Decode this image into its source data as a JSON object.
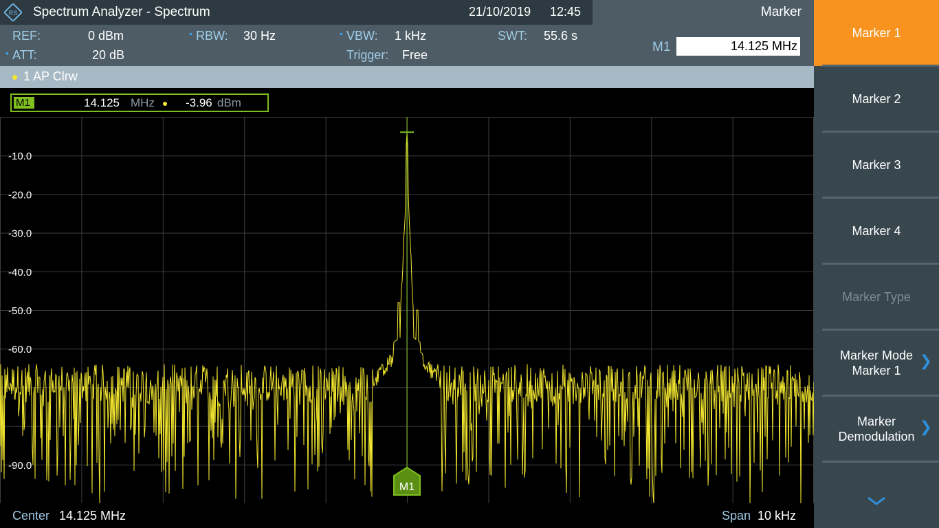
{
  "titlebar": {
    "title": "Spectrum Analyzer - Spectrum",
    "date": "21/10/2019",
    "time": "12:45"
  },
  "marker_panel": {
    "heading": "Marker",
    "m1_label": "M1",
    "m1_value": "14.125 MHz"
  },
  "settings": {
    "ref_label": "REF:",
    "ref_value": "0 dBm",
    "att_label": "ATT:",
    "att_value": "20 dB",
    "rbw_label": "RBW:",
    "rbw_value": "30 Hz",
    "vbw_label": "VBW:",
    "vbw_value": "1 kHz",
    "trigger_label": "Trigger:",
    "trigger_value": "Free",
    "swt_label": "SWT:",
    "swt_value": "55.6 s"
  },
  "trace": {
    "label": "1 AP  Clrw"
  },
  "marker_table": {
    "tag": "M1",
    "freq_value": "14.125",
    "freq_unit": "MHz",
    "level_value": "-3.96",
    "level_unit": "dBm"
  },
  "bottom": {
    "center_label": "Center",
    "center_value": "14.125 MHz",
    "span_label": "Span",
    "span_value": "10 kHz"
  },
  "softkeys": [
    {
      "label": "Marker 1",
      "state": "active"
    },
    {
      "label": "Marker 2",
      "state": "normal"
    },
    {
      "label": "Marker 3",
      "state": "normal"
    },
    {
      "label": "Marker 4",
      "state": "normal"
    },
    {
      "label": "Marker Type",
      "state": "disabled"
    },
    {
      "label": "Marker Mode\nMarker 1",
      "state": "submenu"
    },
    {
      "label": "Marker\nDemodulation",
      "state": "submenu"
    }
  ],
  "colors": {
    "trace": "#f4e830",
    "marker": "#7fbf1f",
    "active_softkey": "#f7931e",
    "label_blue": "#9fcbe6"
  },
  "chart_data": {
    "type": "line",
    "ytick_labels": [
      "-10.0",
      "-20.0",
      "-30.0",
      "-40.0",
      "-50.0",
      "-60.0",
      "-90.0"
    ],
    "ytick_values": [
      -10,
      -20,
      -30,
      -40,
      -50,
      -60,
      -90
    ],
    "ylim": [
      0,
      -100
    ],
    "xlim_khz": [
      -5,
      5
    ],
    "grid": true,
    "series": [
      {
        "peak_offset_khz": 0,
        "peak_level_dbm": -3.96,
        "noise_floor_dbm": -70
      }
    ],
    "marker": {
      "label": "M1",
      "offset_khz": 0,
      "level_dbm": -3.96
    }
  }
}
